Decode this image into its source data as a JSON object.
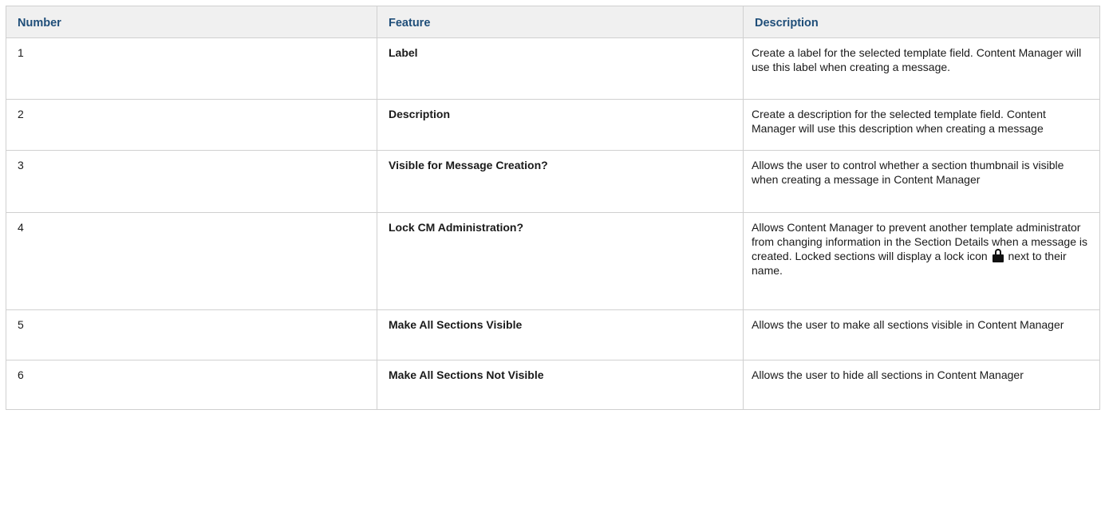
{
  "table": {
    "headers": {
      "number": "Number",
      "feature": "Feature",
      "description": "Description"
    },
    "rows": [
      {
        "number": "1",
        "feature": "Label",
        "description": "Create a label for the selected template field. Content Manager will use this label when creating a message."
      },
      {
        "number": "2",
        "feature": "Description",
        "description": "Create a description for the selected template field. Content Manager will use this description when creating a message"
      },
      {
        "number": "3",
        "feature": "Visible for Message Creation?",
        "description": " Allows the user to control whether a section thumbnail is visible when creating a message in Content Manager"
      },
      {
        "number": "4",
        "feature": "Lock CM Administration?",
        "description_before_icon": "Allows Content Manager to prevent another template administrator from changing information in the Section Details when a message is created. Locked sections will display a lock icon",
        "icon": "lock-icon",
        "description_after_icon": "next to their name."
      },
      {
        "number": "5",
        "feature": "Make All Sections Visible",
        "description": "Allows the user to make all sections visible in Content Manager"
      },
      {
        "number": "6",
        "feature": "Make All Sections Not Visible",
        "description": "Allows the user to hide all sections in Content Manager"
      }
    ]
  },
  "colors": {
    "header_text": "#1f4e79",
    "header_background": "#f0f0f0",
    "border": "#d0d0d0"
  }
}
